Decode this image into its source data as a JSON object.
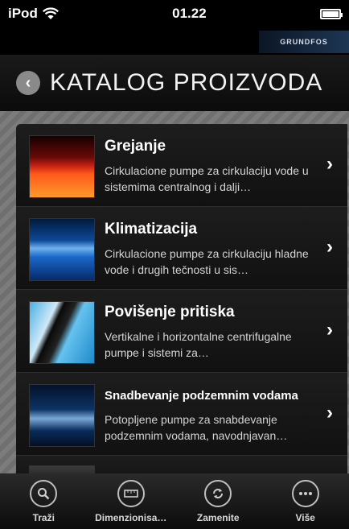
{
  "status_bar": {
    "device": "iPod",
    "time": "01.22"
  },
  "brand": {
    "logo_text": "GRUNDFOS"
  },
  "header": {
    "title": "KATALOG PROIZVODA"
  },
  "items": [
    {
      "title": "Grejanje",
      "description": "Cirkulacione pumpe za cirkulaciju vode u sistemima centralnog i dalji…"
    },
    {
      "title": "Klimatizacija",
      "description": "Cirkulacione pumpe za cirkulaciju hladne vode i drugih tečnosti u sis…"
    },
    {
      "title": "Povišenje pritiska",
      "description": "Vertikalne i horizontalne centrifugalne pumpe i sistemi za…"
    },
    {
      "title": "Snadbevanje podzemnim vodama",
      "description": "Potopljene pumpe za snabdevanje podzemnim vodama, navodnjavan…"
    }
  ],
  "tabs": [
    {
      "label": "Traži",
      "icon": "search-icon"
    },
    {
      "label": "Dimenzionisa…",
      "icon": "ruler-icon"
    },
    {
      "label": "Zamenite",
      "icon": "replace-icon"
    },
    {
      "label": "Više",
      "icon": "more-icon"
    }
  ]
}
